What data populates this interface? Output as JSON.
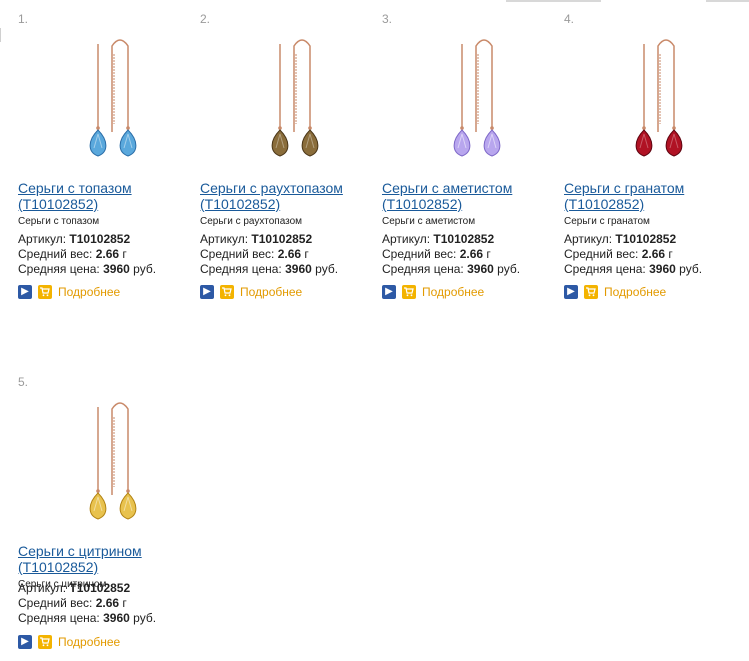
{
  "products": [
    {
      "number": "1.",
      "title_line1": "Серьги с топазом",
      "title_line2": "(T10102852)",
      "subtitle": "Серьги с топазом",
      "article_label": "Артикул:",
      "article_value": "T10102852",
      "weight_label": "Средний вес:",
      "weight_value": "2.66",
      "weight_unit": "г",
      "price_label": "Средняя цена:",
      "price_value": "3960",
      "price_unit": "руб.",
      "more_label": "Подробнее",
      "stone_color": "#5aa8dc",
      "stone_dark": "#2b6ea8"
    },
    {
      "number": "2.",
      "title_line1": "Серьги с раухтопазом",
      "title_line2": "(T10102852)",
      "subtitle": "Серьги с раухтопазом",
      "article_label": "Артикул:",
      "article_value": "T10102852",
      "weight_label": "Средний вес:",
      "weight_value": "2.66",
      "weight_unit": "г",
      "price_label": "Средняя цена:",
      "price_value": "3960",
      "price_unit": "руб.",
      "more_label": "Подробнее",
      "stone_color": "#8a6d3b",
      "stone_dark": "#4a3618"
    },
    {
      "number": "3.",
      "title_line1": "Серьги с аметистом",
      "title_line2": "(T10102852)",
      "subtitle": "Серьги с аметистом",
      "article_label": "Артикул:",
      "article_value": "T10102852",
      "weight_label": "Средний вес:",
      "weight_value": "2.66",
      "weight_unit": "г",
      "price_label": "Средняя цена:",
      "price_value": "3960",
      "price_unit": "руб.",
      "more_label": "Подробнее",
      "stone_color": "#b8a6ee",
      "stone_dark": "#7e68c8"
    },
    {
      "number": "4.",
      "title_line1": "Серьги с гранатом",
      "title_line2": "(T10102852)",
      "subtitle": "Серьги с гранатом",
      "article_label": "Артикул:",
      "article_value": "T10102852",
      "weight_label": "Средний вес:",
      "weight_value": "2.66",
      "weight_unit": "г",
      "price_label": "Средняя цена:",
      "price_value": "3960",
      "price_unit": "руб.",
      "more_label": "Подробнее",
      "stone_color": "#b01224",
      "stone_dark": "#5e0410"
    },
    {
      "number": "5.",
      "title_line1": "Серьги с цитрином",
      "title_line2": "(T10102852)",
      "subtitle": "Серьги с цитрином",
      "article_label": "Артикул:",
      "article_value": "T10102852",
      "weight_label": "Средний вес:",
      "weight_value": "2.66",
      "weight_unit": "г",
      "price_label": "Средняя цена:",
      "price_value": "3960",
      "price_unit": "руб.",
      "more_label": "Подробнее",
      "stone_color": "#e8c24e",
      "stone_dark": "#b38414"
    }
  ],
  "colors": {
    "link": "#1a5a9a",
    "more": "#e29a00",
    "arrow_button": "#2d59a5",
    "cart_button": "#f3b300",
    "metal": "#c98a6a"
  },
  "icons": {
    "arrow": "chevron-right-icon",
    "cart": "cart-icon"
  }
}
